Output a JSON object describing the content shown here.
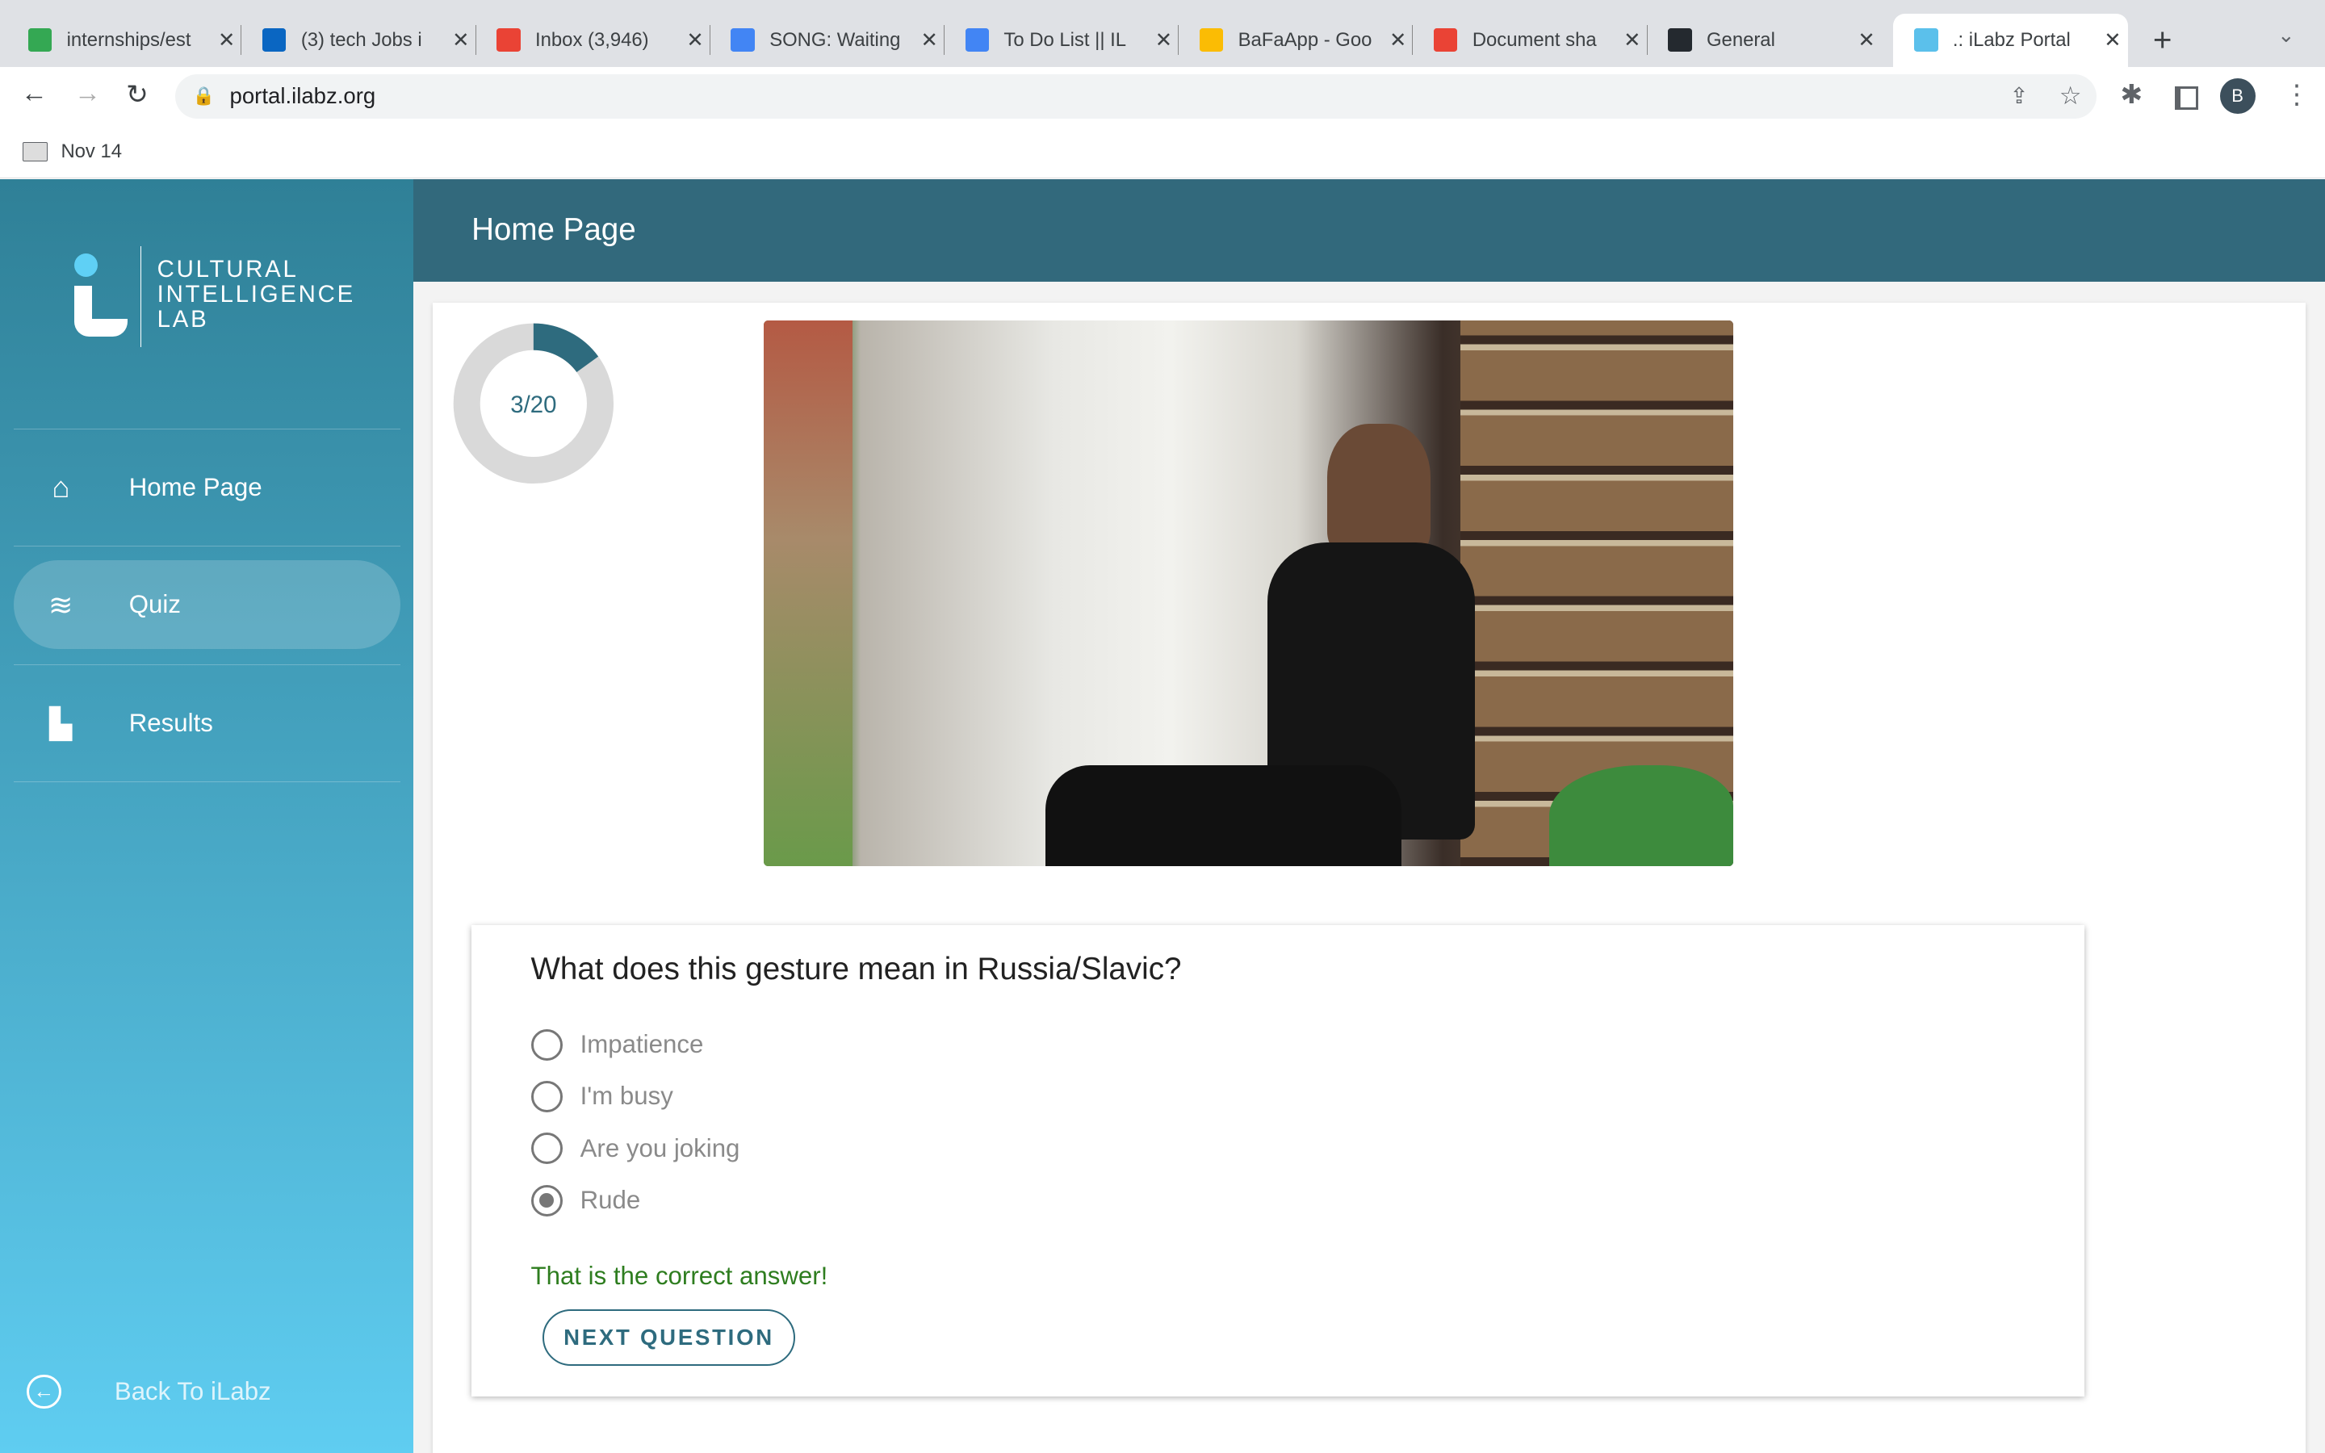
{
  "browser": {
    "tabs": [
      {
        "title": "internships/est",
        "icon": "sheets-icon",
        "color": "#34a853"
      },
      {
        "title": "(3) tech Jobs i",
        "icon": "linkedin-icon",
        "color": "#0a66c2"
      },
      {
        "title": "Inbox (3,946)",
        "icon": "gmail-icon",
        "color": "#ea4335"
      },
      {
        "title": "SONG: Waiting",
        "icon": "docs-icon",
        "color": "#4285f4"
      },
      {
        "title": "To Do List || IL",
        "icon": "docs-icon",
        "color": "#4285f4"
      },
      {
        "title": "BaFaApp - Goo",
        "icon": "drive-icon",
        "color": "#fbbc04"
      },
      {
        "title": "Document sha",
        "icon": "gmail-icon",
        "color": "#ea4335"
      },
      {
        "title": "General",
        "icon": "github-icon",
        "color": "#24292f"
      },
      {
        "title": ".: iLabz Portal",
        "icon": "ilabz-icon",
        "color": "#5bc0eb",
        "active": true
      }
    ],
    "url": "portal.ilabz.org",
    "profile_initial": "B",
    "bookmark": "Nov 14"
  },
  "sidebar": {
    "logo_lines": [
      "CULTURAL",
      "INTELLIGENCE",
      "LAB"
    ],
    "items": [
      {
        "label": "Home Page",
        "icon": "home-icon"
      },
      {
        "label": "Quiz",
        "icon": "database-icon",
        "active": true
      },
      {
        "label": "Results",
        "icon": "bar-chart-icon"
      }
    ],
    "back_label": "Back To iLabz"
  },
  "header": {
    "title": "Home Page"
  },
  "quiz": {
    "progress_text": "3/20",
    "progress_fraction": 0.15,
    "question": "What does this gesture mean in Russia/Slavic?",
    "options": [
      "Impatience",
      "I'm busy",
      "Are you joking",
      "Rude"
    ],
    "selected": 3,
    "feedback": "That is the correct answer!",
    "next_label": "NEXT QUESTION"
  },
  "colors": {
    "header": "#32697c",
    "accent": "#2e6b7e",
    "correct": "#2e7d1f"
  }
}
